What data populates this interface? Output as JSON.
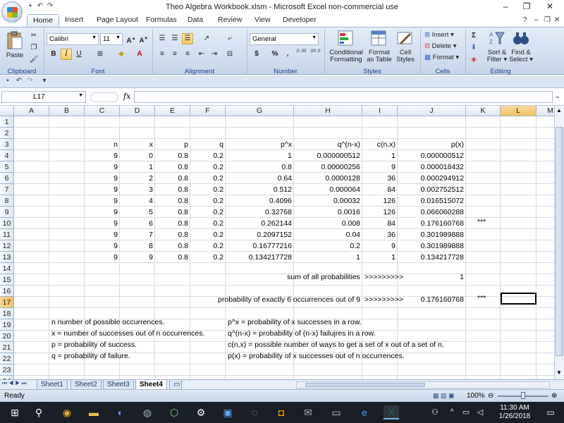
{
  "window": {
    "title": "Theo Algebra Workbook.xlsm - Microsoft Excel non-commercial use",
    "controls": [
      "–",
      "❐",
      "✕"
    ]
  },
  "ribbon": {
    "tabs": [
      "Home",
      "Insert",
      "Page Layout",
      "Formulas",
      "Data",
      "Review",
      "View",
      "Developer"
    ],
    "active_tab": "Home",
    "clipboard": {
      "paste": "Paste",
      "label": "Clipboard"
    },
    "font": {
      "name": "Calibri",
      "size": "11",
      "bold": "B",
      "italic": "I",
      "underline": "U",
      "label": "Font"
    },
    "alignment": {
      "label": "Alignment"
    },
    "number": {
      "format": "General",
      "currency": "$",
      "percent": "%",
      "comma": ",",
      "inc_dec": ".0 .00",
      "dec_dec": ".00 .0",
      "label": "Number"
    },
    "styles": {
      "conditional": "Conditional",
      "conditional2": "Formatting",
      "format_table": "Format",
      "format_table2": "as Table",
      "cell_styles": "Cell",
      "cell_styles2": "Styles",
      "label": "Styles"
    },
    "cells": {
      "insert": "Insert",
      "delete": "Delete",
      "format": "Format",
      "label": "Cells"
    },
    "editing": {
      "sort": "Sort &",
      "sort2": "Filter",
      "find": "Find &",
      "find2": "Select",
      "label": "Editing"
    }
  },
  "formula_bar": {
    "name_box": "L17",
    "fx": "fx",
    "value": ""
  },
  "grid": {
    "columns": [
      "A",
      "B",
      "C",
      "D",
      "E",
      "F",
      "G",
      "H",
      "I",
      "J",
      "K",
      "L",
      "M"
    ],
    "rows": [
      "1",
      "2",
      "3",
      "4",
      "5",
      "6",
      "7",
      "8",
      "9",
      "10",
      "11",
      "12",
      "13",
      "14",
      "15",
      "16",
      "17",
      "18",
      "19",
      "20",
      "21",
      "22",
      "23",
      "24"
    ],
    "selected_cell": "L17",
    "headers": {
      "n": "n",
      "x": "x",
      "p": "p",
      "q": "q",
      "px": "p^x",
      "qnx": "q^(n-x)",
      "cnx": "c(n,x)",
      "pofx": "p(x)"
    },
    "table": [
      [
        "9",
        "0",
        "0.8",
        "0.2",
        "1",
        "0.000000512",
        "1",
        "0.000000512",
        ""
      ],
      [
        "9",
        "1",
        "0.8",
        "0.2",
        "0.8",
        "0.00000256",
        "9",
        "0.000018432",
        ""
      ],
      [
        "9",
        "2",
        "0.8",
        "0.2",
        "0.64",
        "0.0000128",
        "36",
        "0.000294912",
        ""
      ],
      [
        "9",
        "3",
        "0.8",
        "0.2",
        "0.512",
        "0.000064",
        "84",
        "0.002752512",
        ""
      ],
      [
        "9",
        "4",
        "0.8",
        "0.2",
        "0.4096",
        "0.00032",
        "126",
        "0.016515072",
        ""
      ],
      [
        "9",
        "5",
        "0.8",
        "0.2",
        "0.32768",
        "0.0016",
        "126",
        "0.066060288",
        ""
      ],
      [
        "9",
        "6",
        "0.8",
        "0.2",
        "0.262144",
        "0.008",
        "84",
        "0.176160768",
        "***"
      ],
      [
        "9",
        "7",
        "0.8",
        "0.2",
        "0.2097152",
        "0.04",
        "36",
        "0.301989888",
        ""
      ],
      [
        "9",
        "8",
        "0.8",
        "0.2",
        "0.16777216",
        "0.2",
        "9",
        "0.301989888",
        ""
      ],
      [
        "9",
        "9",
        "0.8",
        "0.2",
        "0.134217728",
        "1",
        "1",
        "0.134217728",
        ""
      ]
    ],
    "sum_label": "sum of all probabilities",
    "sum_arrow": ">>>>>>>>>",
    "sum_value": "1",
    "exact_label": "probability of exactly 6 occurrences out of 9",
    "exact_arrow": ">>>>>>>>>",
    "exact_value": "0.176160768",
    "exact_mark": "***",
    "notes_left": [
      "n  number of possible occurrences.",
      "x = number of successes out of n occurrences.",
      "p = probability of success.",
      "q = probability of failure."
    ],
    "notes_right": [
      "p^x = probability of x successes in a row.",
      "q^(n-x) = probability of (n-x) failujres in a row.",
      "c(n,x) = possible number of ways to get a set of x out of a set of n.",
      "p(x) = probability of x successes out of n occurrences."
    ]
  },
  "sheets": [
    "Sheet1",
    "Sheet2",
    "Sheet3",
    "Sheet4"
  ],
  "active_sheet": "Sheet4",
  "status": {
    "text": "Ready",
    "zoom": "100%"
  },
  "taskbar": {
    "time": "11:30 AM",
    "date": "1/26/2018"
  }
}
